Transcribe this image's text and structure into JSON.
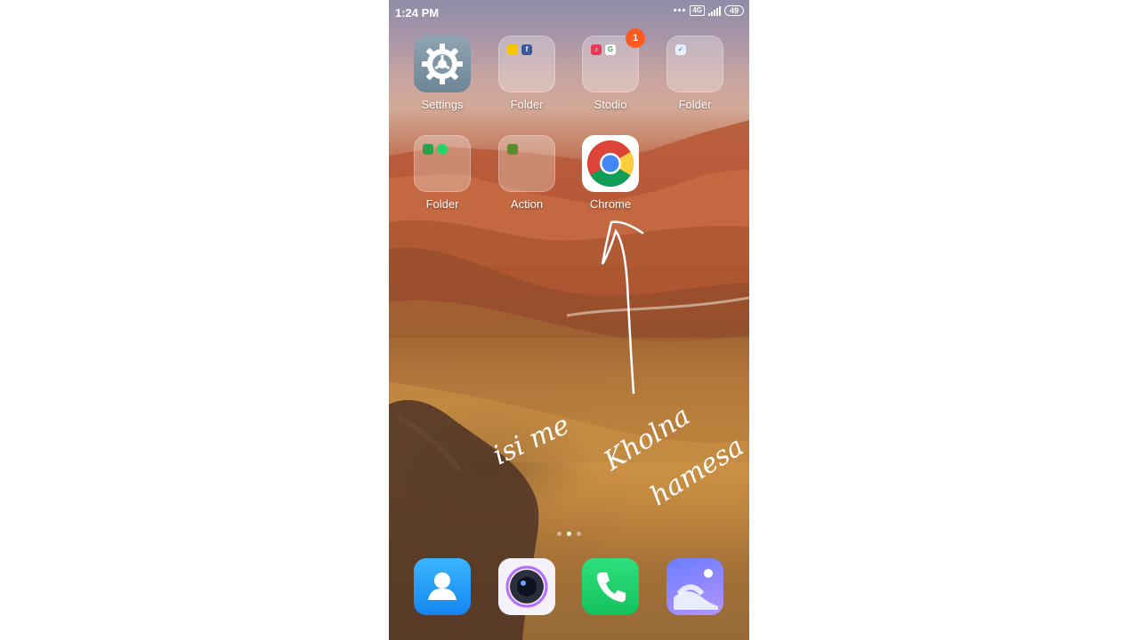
{
  "status_bar": {
    "time": "1:24 PM",
    "network_badge": "4G",
    "battery": "49"
  },
  "apps": [
    {
      "label": "Settings",
      "icon": "gear-icon"
    },
    {
      "label": "Folder",
      "icon": "folder-icon"
    },
    {
      "label": "Stodio",
      "icon": "folder-icon",
      "badge": "1"
    },
    {
      "label": "Folder",
      "icon": "folder-icon"
    },
    {
      "label": "Folder",
      "icon": "folder-icon"
    },
    {
      "label": "Action",
      "icon": "folder-icon"
    },
    {
      "label": "Chrome",
      "icon": "chrome-icon"
    }
  ],
  "dock": [
    {
      "icon": "contacts-icon"
    },
    {
      "icon": "camera-icon"
    },
    {
      "icon": "phone-icon"
    },
    {
      "icon": "gallery-icon"
    }
  ],
  "annotation": {
    "line1": "isi me",
    "line2": "Kholna",
    "line3": "hamesa"
  },
  "colors": {
    "badge": "#ff5a1f",
    "phone_green": "#1fd16b",
    "contacts_blue": "#1e9af5",
    "gallery_purple": "#8d8cf5"
  }
}
